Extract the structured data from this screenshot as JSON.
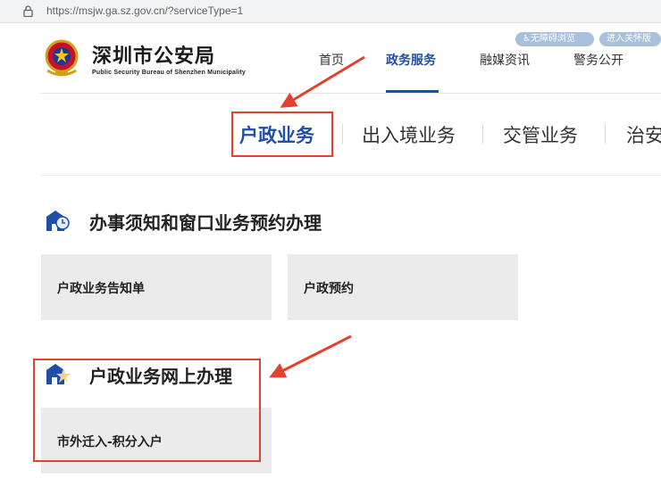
{
  "browser": {
    "url": "https://msjw.ga.sz.gov.cn/?serviceType=1"
  },
  "header": {
    "title_cn": "深圳市公安局",
    "title_en": "Public Security Bureau of Shenzhen Municipality",
    "nav": [
      {
        "label": "首页"
      },
      {
        "label": "政务服务",
        "active": true
      },
      {
        "label": "融媒资讯"
      },
      {
        "label": "警务公开"
      }
    ],
    "accessibility_label": "无障碍浏览",
    "care_mode_label": "进入关怀版"
  },
  "service_tabs": [
    {
      "label": "户政业务",
      "active": true
    },
    {
      "label": "出入境业务"
    },
    {
      "label": "交管业务"
    },
    {
      "label": "治安"
    }
  ],
  "sections": [
    {
      "title": "办事须知和窗口业务预约办理",
      "cards": [
        "户政业务告知单",
        "户政预约"
      ]
    },
    {
      "title": "户政业务网上办理",
      "cards": [
        "市外迁入-积分入户"
      ]
    }
  ],
  "colors": {
    "brand_blue": "#1e4ea8",
    "annotation_red": "#e3402d",
    "card_bg": "#ebebeb"
  },
  "icons": {
    "lock": "lock-icon",
    "emblem": "police-emblem-icon",
    "section1": "building-clock-icon",
    "section2": "building-star-icon"
  }
}
